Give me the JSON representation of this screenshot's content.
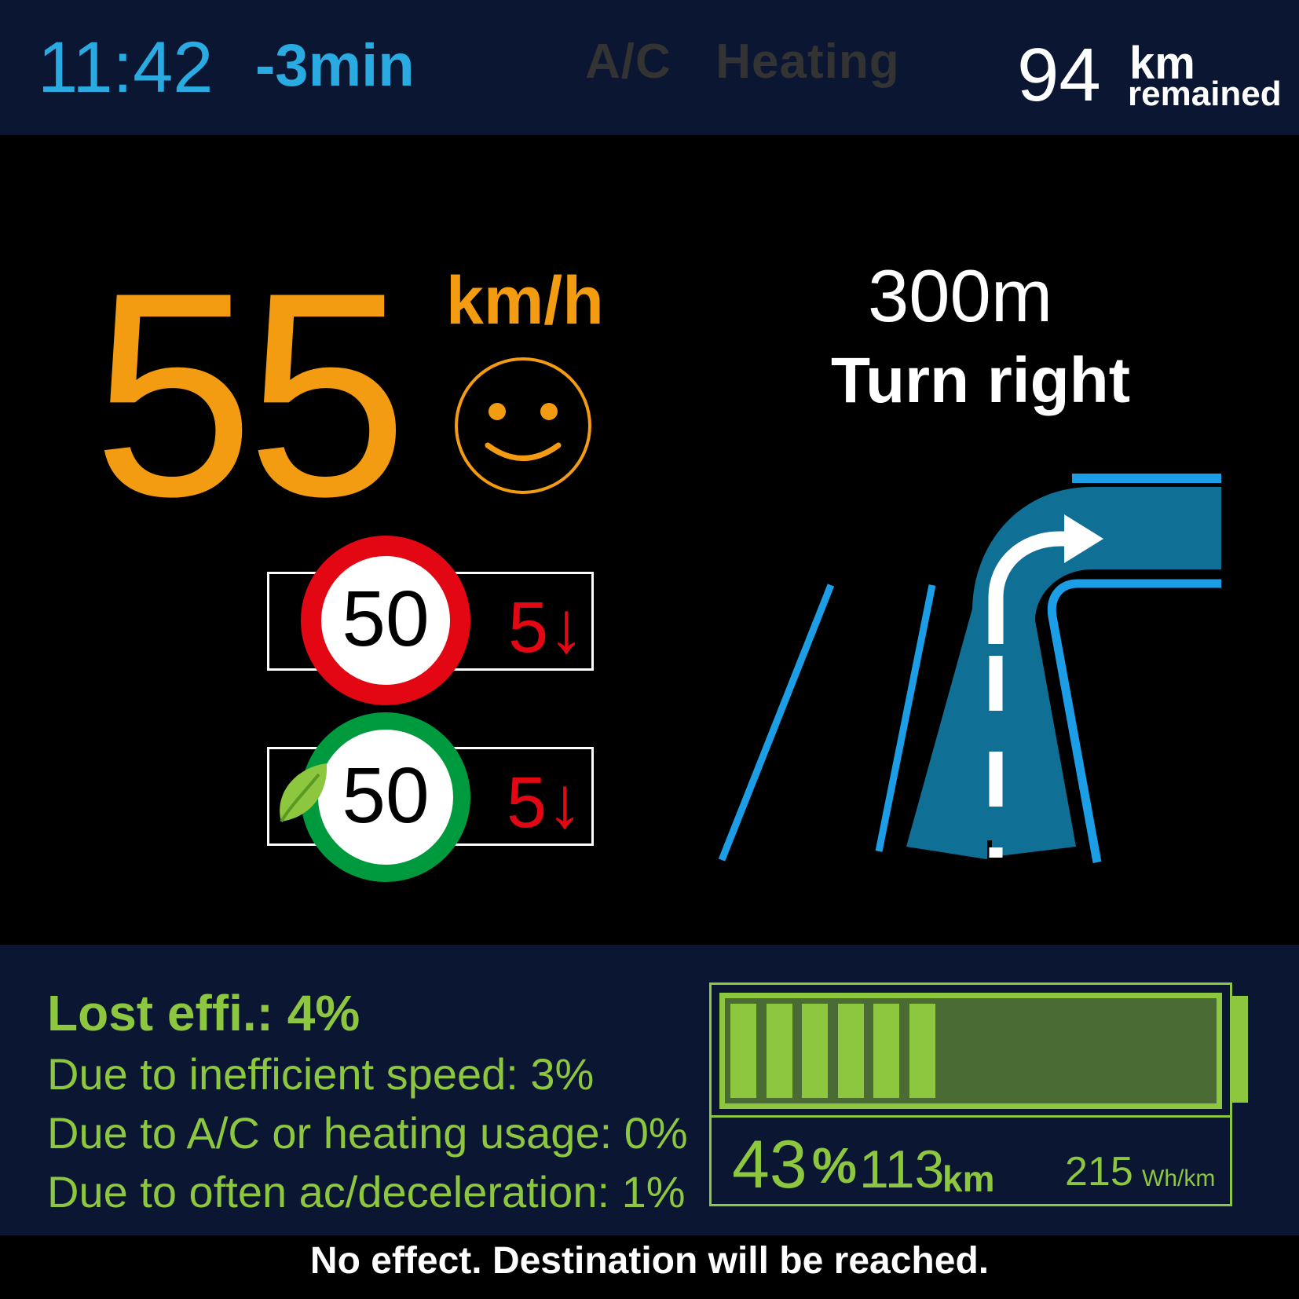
{
  "top_bar": {
    "clock": "11:42",
    "eta_delta": "-3min",
    "climate": {
      "ac": "A/C",
      "heating": "Heating"
    },
    "range": {
      "value": "94",
      "unit": "km",
      "label": "remained"
    }
  },
  "speed": {
    "value": "55",
    "unit": "km/h",
    "mood_icon": "smiley-face-icon"
  },
  "navigation": {
    "distance": "300m",
    "instruction": "Turn right",
    "icon": "turn-right-road-icon"
  },
  "speed_limits": [
    {
      "type": "regulatory",
      "limit": "50",
      "delta": "5↓",
      "ring_color": "#e30613"
    },
    {
      "type": "eco",
      "limit": "50",
      "delta": "5↓",
      "ring_color": "#009a3e",
      "icon": "leaf-icon"
    }
  ],
  "efficiency": {
    "title": "Lost effi.: 4%",
    "rows": [
      "Due to inefficient speed: 3%",
      "Due to A/C or heating usage: 0%",
      "Due to often ac/deceleration: 1%"
    ]
  },
  "battery": {
    "level_fraction": 0.43,
    "percent": "43",
    "percent_unit": "%",
    "range": "113",
    "range_unit": "km",
    "consumption": "215",
    "consumption_unit": "Wh/km"
  },
  "footer": {
    "message": "No effect. Destination will be reached."
  },
  "colors": {
    "bar_background": "#0b1632",
    "accent_blue": "#29abe2",
    "speed_orange": "#f39c12",
    "eco_green": "#8dc63f",
    "alert_red": "#e30613"
  }
}
